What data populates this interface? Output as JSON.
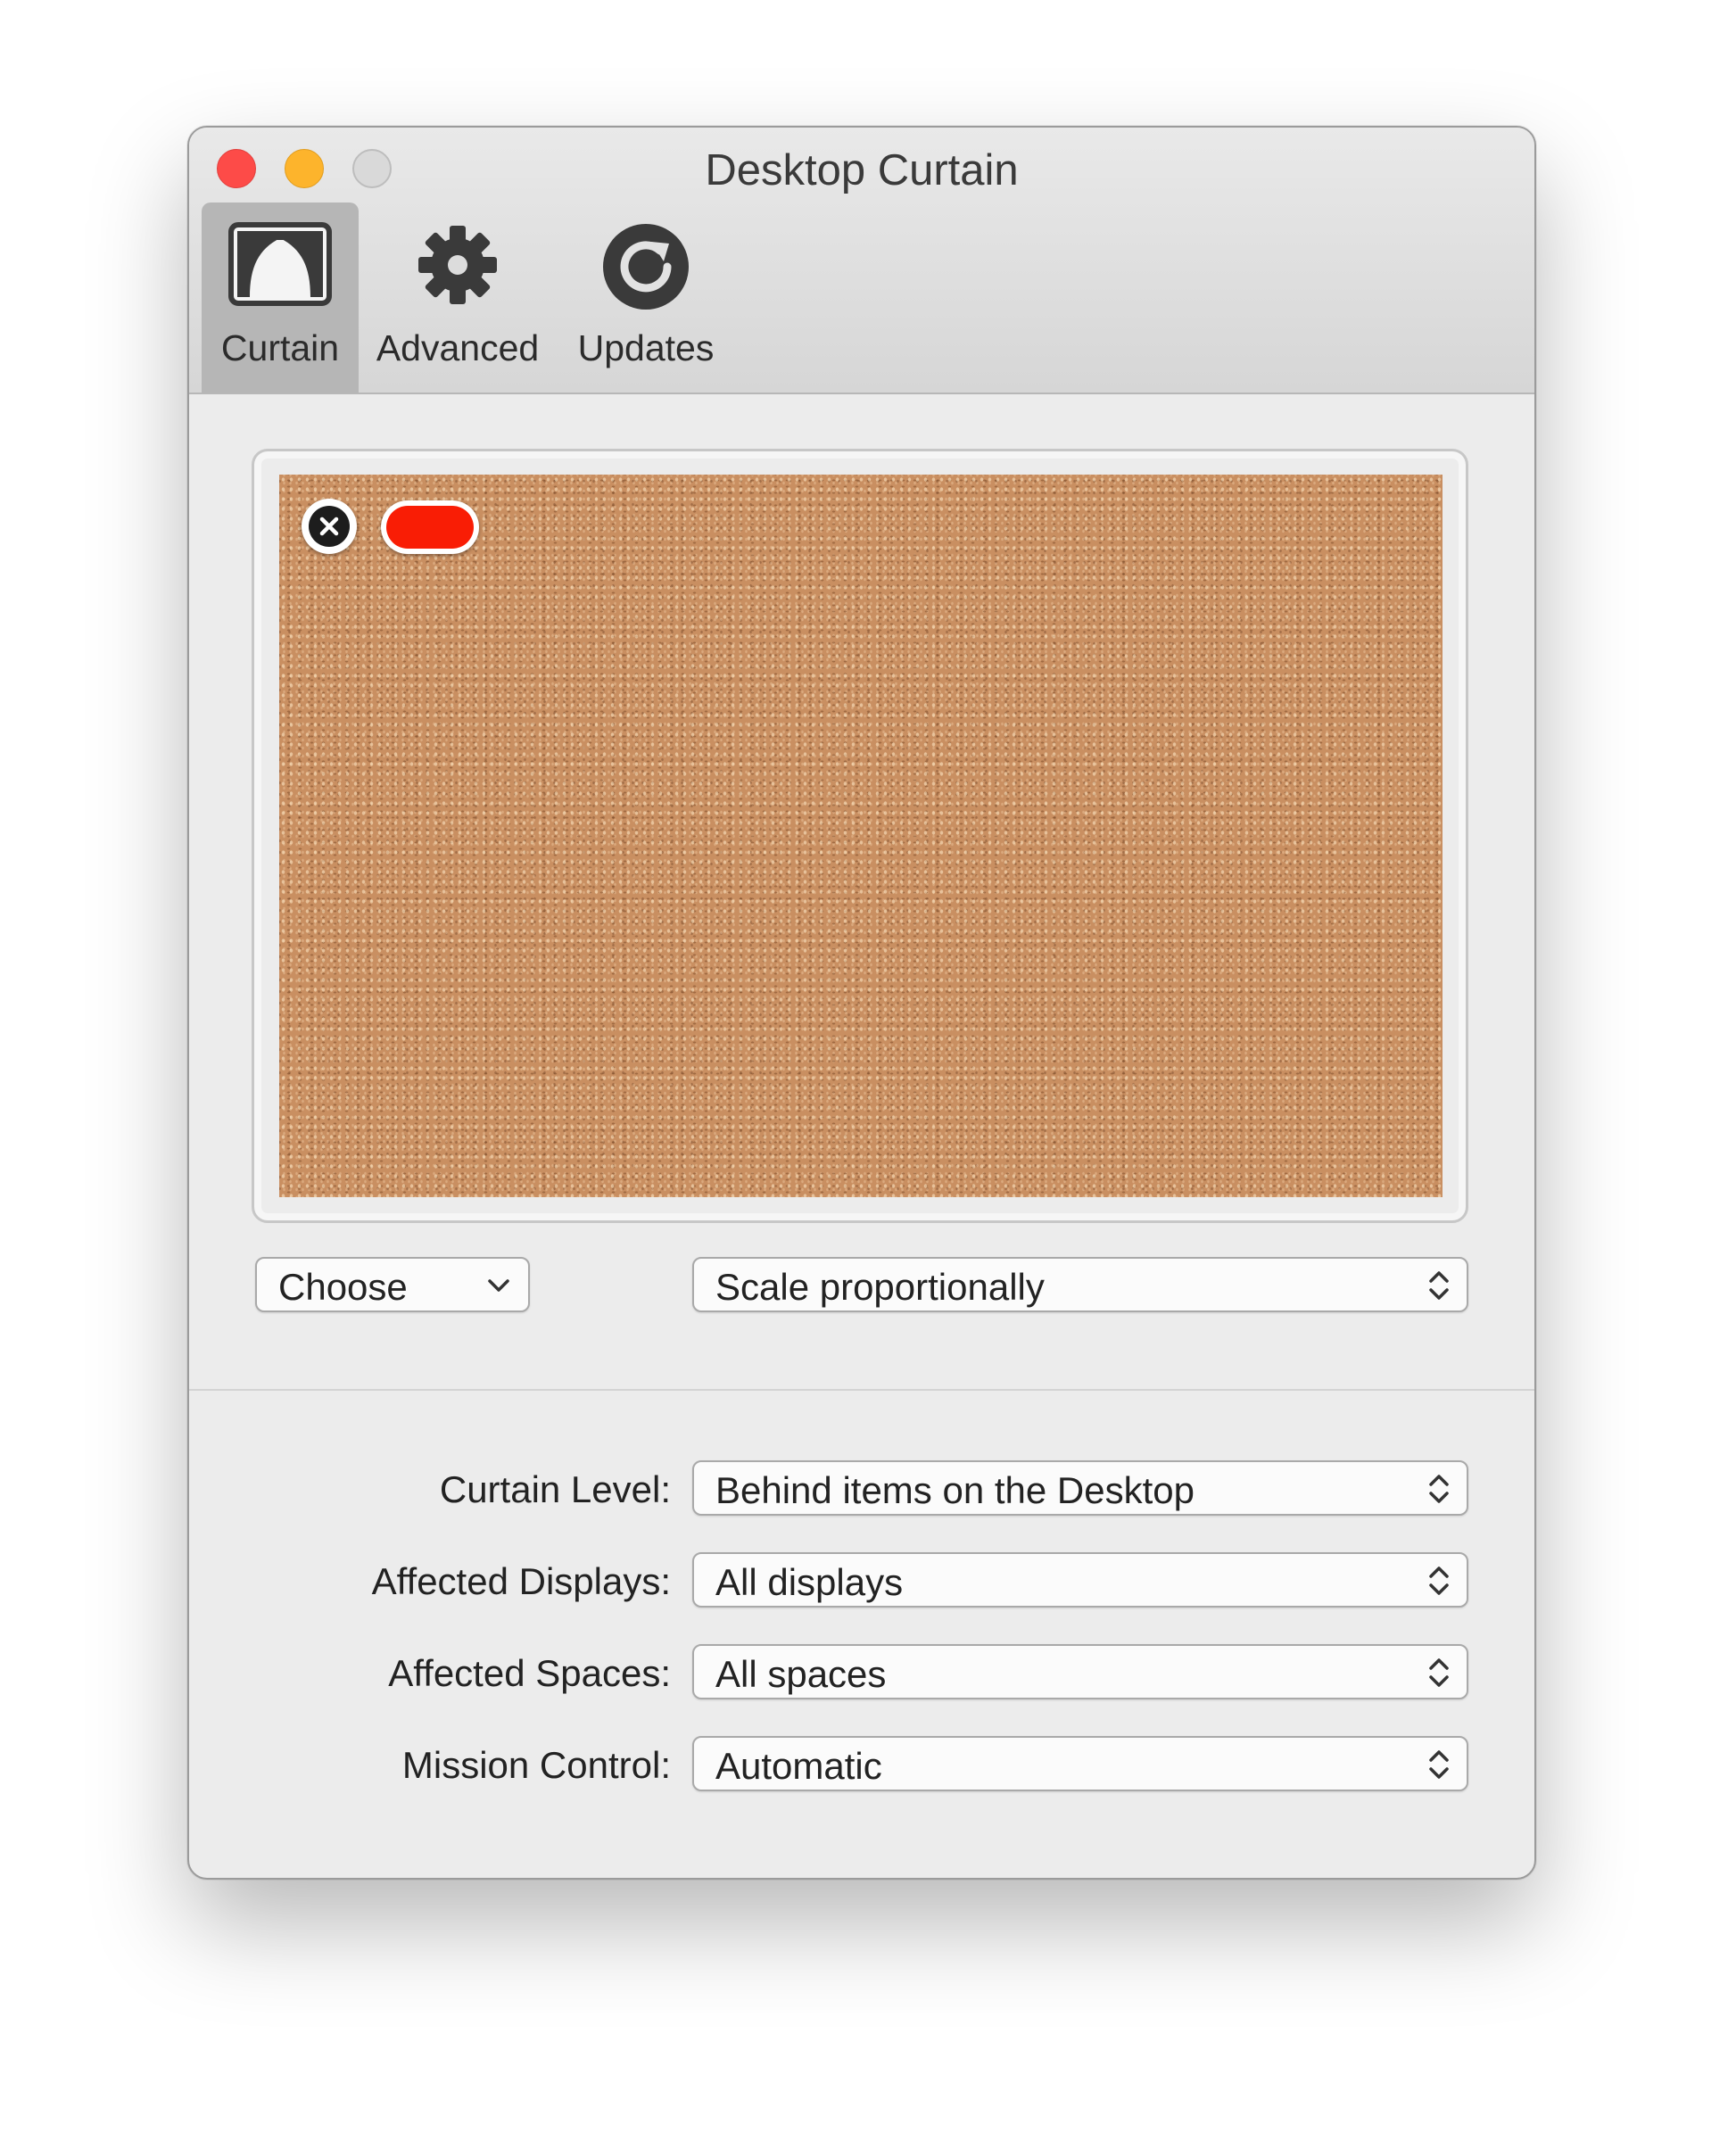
{
  "window": {
    "title": "Desktop Curtain"
  },
  "toolbar": {
    "tabs": [
      {
        "label": "Curtain",
        "icon": "curtain-icon",
        "selected": true
      },
      {
        "label": "Advanced",
        "icon": "gear-icon",
        "selected": false
      },
      {
        "label": "Updates",
        "icon": "refresh-icon",
        "selected": false
      }
    ]
  },
  "preview": {
    "background": "cork-texture",
    "color_well": "#f91d05"
  },
  "image_controls": {
    "choose_label": "Choose",
    "scale_label": "Scale proportionally"
  },
  "settings": [
    {
      "label": "Curtain Level:",
      "value": "Behind items on the Desktop"
    },
    {
      "label": "Affected Displays:",
      "value": "All displays"
    },
    {
      "label": "Affected Spaces:",
      "value": "All spaces"
    },
    {
      "label": "Mission Control:",
      "value": "Automatic"
    }
  ]
}
